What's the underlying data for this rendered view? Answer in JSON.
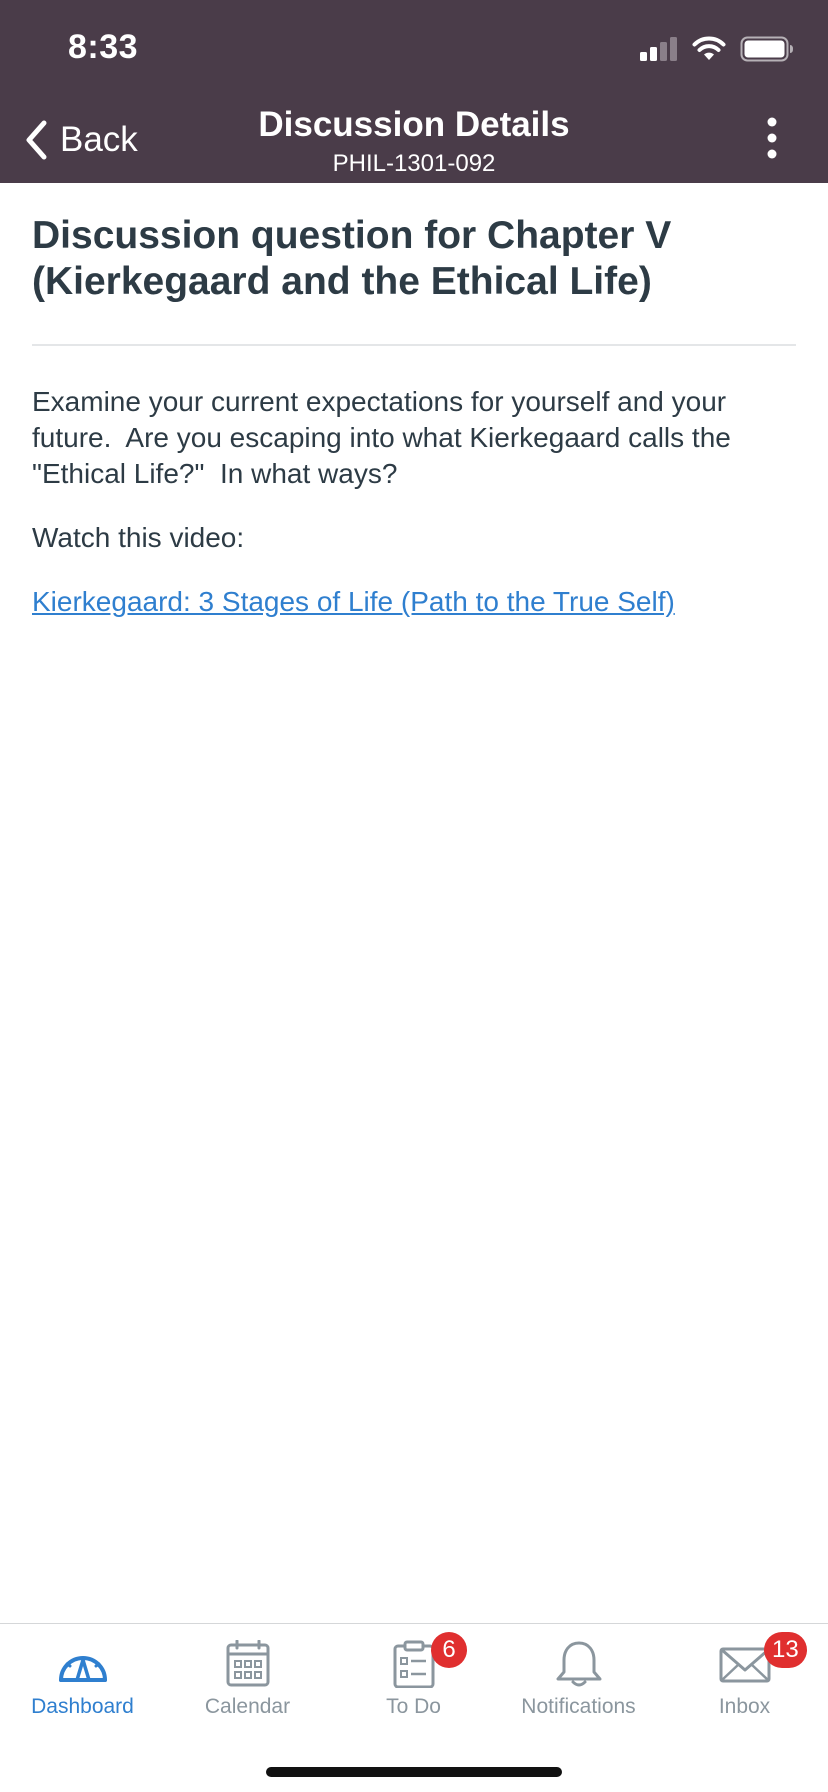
{
  "status_bar": {
    "time": "8:33"
  },
  "nav": {
    "back_label": "Back",
    "title": "Discussion Details",
    "subtitle": "PHIL-1301-092"
  },
  "discussion": {
    "title": "Discussion question for Chapter V (Kierkegaard and the Ethical Life)",
    "body": "Examine your current expectations for yourself and your future.  Are you escaping into what Kierkegaard calls the \"Ethical Life?\"  In what ways?",
    "watch_label": "Watch this video:",
    "link_text": "Kierkegaard: 3 Stages of Life (Path to the True Self)"
  },
  "tabbar": {
    "tabs": [
      {
        "label": "Dashboard",
        "icon": "dashboard-gauge-icon",
        "active": true
      },
      {
        "label": "Calendar",
        "icon": "calendar-icon",
        "active": false
      },
      {
        "label": "To Do",
        "icon": "clipboard-todo-icon",
        "active": false,
        "badge": "6"
      },
      {
        "label": "Notifications",
        "icon": "bell-icon",
        "active": false
      },
      {
        "label": "Inbox",
        "icon": "envelope-icon",
        "active": false,
        "badge": "13"
      }
    ]
  },
  "colors": {
    "header_background": "#4a3c49",
    "accent": "#2f7fcf",
    "text": "#2d3b45",
    "badge": "#e02f2f",
    "inactive_tab": "#8b969e"
  }
}
